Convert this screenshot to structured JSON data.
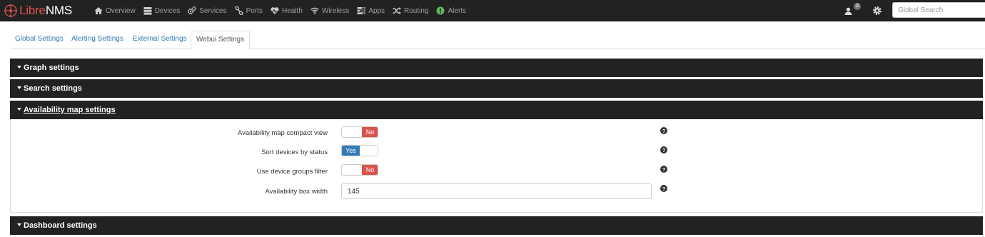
{
  "brand": {
    "libre": "Libre",
    "nms": "NMS"
  },
  "nav": {
    "items": [
      {
        "label": "Overview",
        "icon": "home-icon"
      },
      {
        "label": "Devices",
        "icon": "server-icon"
      },
      {
        "label": "Services",
        "icon": "cogs-icon"
      },
      {
        "label": "Ports",
        "icon": "link-icon"
      },
      {
        "label": "Health",
        "icon": "heartbeat-icon"
      },
      {
        "label": "Wireless",
        "icon": "wifi-icon"
      },
      {
        "label": "Apps",
        "icon": "tasks-icon"
      },
      {
        "label": "Routing",
        "icon": "random-icon"
      },
      {
        "label": "Alerts",
        "icon": "exclamation-circle-icon"
      }
    ],
    "user_badge": "0",
    "search_placeholder": "Global Search"
  },
  "tabs": [
    {
      "label": "Global Settings",
      "active": false
    },
    {
      "label": "Alerting Settings",
      "active": false
    },
    {
      "label": "External Settings",
      "active": false
    },
    {
      "label": "Webui Settings",
      "active": true
    }
  ],
  "sections": [
    {
      "title": "Graph settings",
      "open": false
    },
    {
      "title": "Search settings",
      "open": false
    },
    {
      "title": "Availability map settings",
      "open": true
    },
    {
      "title": "Dashboard settings",
      "open": false
    }
  ],
  "availability": {
    "rows": [
      {
        "label": "Availability map compact view",
        "type": "toggle",
        "value": "No"
      },
      {
        "label": "Sort devices by status",
        "type": "toggle",
        "value": "Yes"
      },
      {
        "label": "Use device groups filter",
        "type": "toggle",
        "value": "No"
      },
      {
        "label": "Availability box width",
        "type": "text",
        "value": "145"
      }
    ]
  },
  "colors": {
    "navbar": "#222222",
    "brand_red": "#d9534f",
    "toggle_no": "#d9534f",
    "toggle_yes": "#337ab7",
    "link": "#337ab7"
  }
}
